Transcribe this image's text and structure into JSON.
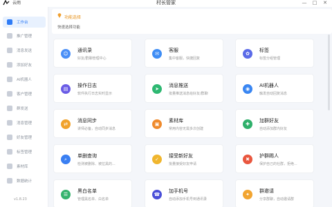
{
  "titlebar": {
    "app_name": "云雨",
    "window_title": "村长管家",
    "minimize": "—",
    "maximize": "□",
    "close": "✕"
  },
  "sidebar": {
    "items": [
      {
        "label": "工作台",
        "active": true
      },
      {
        "label": "推广管理"
      },
      {
        "label": "消息发送"
      },
      {
        "label": "添加好友"
      },
      {
        "label": "AI机器人"
      },
      {
        "label": "客户管理"
      },
      {
        "label": "群发送"
      },
      {
        "label": "消息管理"
      },
      {
        "label": "好友管理"
      },
      {
        "label": "标签管理"
      },
      {
        "label": "素材库"
      },
      {
        "label": "数据统计"
      }
    ],
    "version": "v1.8.23"
  },
  "func_header": {
    "title": "功能选择",
    "subtitle": "快速选择功能"
  },
  "cards": [
    {
      "title": "通讯录",
      "desc": "好友/群聊管理中心",
      "color": "#4a8ff7",
      "glyph": "☺"
    },
    {
      "title": "客服",
      "desc": "集中客服，快捷回复",
      "color": "#3e8df5",
      "glyph": "✉"
    },
    {
      "title": "标签",
      "desc": "标签分组管理",
      "color": "#5b6be8",
      "glyph": "✿"
    },
    {
      "title": "操作日志",
      "desc": "软件执行日志实时显示",
      "color": "#6a5ce6",
      "glyph": "▤"
    },
    {
      "title": "消息推送",
      "desc": "批量推送消息给好友/群聊",
      "color": "#2eb872",
      "glyph": "➤"
    },
    {
      "title": "AI机器人",
      "desc": "触发自动回复消息",
      "color": "#3a86f2",
      "glyph": "◉"
    },
    {
      "title": "消息同步",
      "desc": "讲师必备，自动同步消息",
      "color": "#f1a22b",
      "glyph": "⇄"
    },
    {
      "title": "素材库",
      "desc": "常用内容无需多次创建",
      "color": "#ef8a2c",
      "glyph": "▣"
    },
    {
      "title": "加群好友",
      "desc": "自动添加群内好友",
      "color": "#2fb06b",
      "glyph": "✚"
    },
    {
      "title": "单删查询",
      "desc": "检测被删除、被拉黑的...",
      "color": "#3a7ff2",
      "glyph": "⌕"
    },
    {
      "title": "接受新好友",
      "desc": "批量接受好友申请",
      "color": "#f0b62e",
      "glyph": "✓"
    },
    {
      "title": "护群踢人",
      "desc": "保护自己的社群，拒绝...",
      "color": "#e9573f",
      "glyph": "✖"
    },
    {
      "title": "黑白名单",
      "desc": "管理黑名单、白名单",
      "color": "#36b36d",
      "glyph": "☰"
    },
    {
      "title": "加手机号",
      "desc": "自动添加手机号到通讯录",
      "color": "#4a4fd8",
      "glyph": "☎"
    },
    {
      "title": "群邀请",
      "desc": "分享群聊，自动邀请群",
      "color": "#f2a531",
      "glyph": "✦"
    }
  ]
}
